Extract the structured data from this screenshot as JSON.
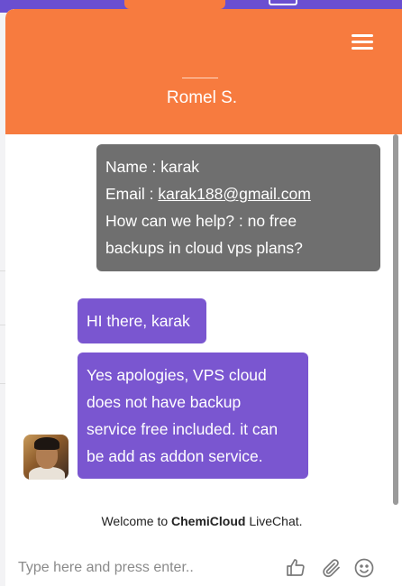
{
  "header": {
    "agent_name": "Romel S.",
    "menu_icon": "hamburger-menu-icon",
    "color": "#f77b3f"
  },
  "messages": {
    "visitor": {
      "name_line": "Name : karak",
      "email_prefix": "Email : ",
      "email": "karak188@gmail.com",
      "question_line1": "How can we help? : no free",
      "question_line2": "backups in cloud vps plans?",
      "color": "#6f6f6f"
    },
    "agent_1": {
      "text": "HI there, karak",
      "color": "#7a56d0"
    },
    "agent_2": {
      "line1": "Yes apologies, VPS cloud",
      "line2": "does not have backup",
      "line3": "service free included. it can",
      "line4": "be add as addon service.",
      "color": "#7a56d0"
    }
  },
  "footer": {
    "welcome_prefix": "Welcome to ",
    "welcome_brand": "ChemiCloud",
    "welcome_suffix": " LiveChat."
  },
  "input": {
    "placeholder": "Type here and press enter..",
    "value": ""
  },
  "icons": [
    "hamburger-menu-icon",
    "thumbs-up-icon",
    "paperclip-icon",
    "smiley-icon",
    "agent-avatar"
  ]
}
